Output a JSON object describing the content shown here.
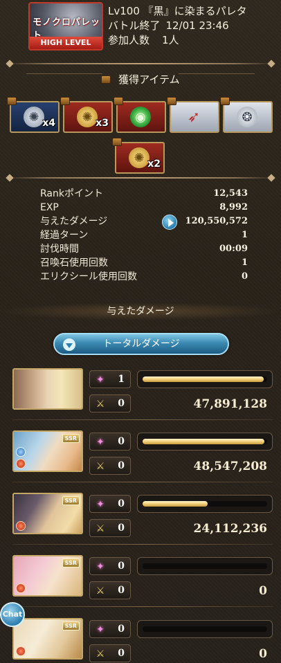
{
  "quest": {
    "thumb_logo": "モノクロパレット",
    "thumb_level": "HIGH LEVEL",
    "name": "Lv100 『黒』に染まるパレタ",
    "battle_end_label": "バトル終了",
    "battle_end_value": "12/01 23:46",
    "participants_label": "参加人数",
    "participants_value": "1人"
  },
  "items_section": {
    "title": "獲得アイテム",
    "items": [
      {
        "name": "silver-medal",
        "qty": "x4",
        "style": "blue"
      },
      {
        "name": "gold-medal",
        "qty": "x3",
        "style": "red"
      },
      {
        "name": "green-orb",
        "qty": "",
        "style": "red"
      },
      {
        "name": "enhancement-material",
        "qty": "",
        "style": "silver"
      },
      {
        "name": "silver-scroll",
        "qty": "",
        "style": "silver"
      },
      {
        "name": "gold-medal-2",
        "qty": "x2",
        "style": "red"
      }
    ]
  },
  "stats": [
    {
      "label": "Rankポイント",
      "value": "12,543"
    },
    {
      "label": "EXP",
      "value": "8,992"
    },
    {
      "label": "与えたダメージ",
      "value": "120,550,572"
    },
    {
      "label": "経過ターン",
      "value": "1"
    },
    {
      "label": "討伐時間",
      "value": "00:09"
    },
    {
      "label": "召喚石使用回数",
      "value": "1"
    },
    {
      "label": "エリクシール使用回数",
      "value": "0"
    }
  ],
  "damage_section": {
    "title": "与えたダメージ",
    "total_button": "トータルダメージ"
  },
  "characters": [
    {
      "name": "main-character",
      "special": "1",
      "attack": "0",
      "fill": 0.97,
      "damage": "47,891,128"
    },
    {
      "name": "character-2",
      "special": "0",
      "attack": "0",
      "fill": 0.98,
      "damage": "48,547,208"
    },
    {
      "name": "character-3",
      "special": "0",
      "attack": "0",
      "fill": 0.52,
      "damage": "24,112,236"
    },
    {
      "name": "character-4",
      "special": "0",
      "attack": "0",
      "fill": 0.0,
      "damage": "0"
    },
    {
      "name": "character-5",
      "special": "0",
      "attack": "0",
      "fill": 0.0,
      "damage": "0"
    }
  ],
  "chat_button": "Chat"
}
